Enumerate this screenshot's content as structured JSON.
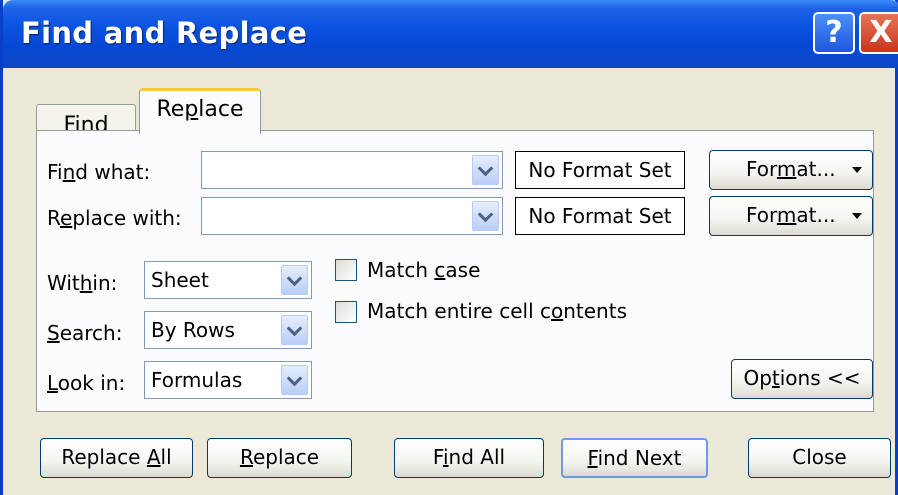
{
  "window": {
    "title": "Find and Replace",
    "help_glyph": "?",
    "close_glyph": "X"
  },
  "tabs": [
    {
      "label_pre": "Fin",
      "label_u": "d",
      "label_post": "",
      "active": false
    },
    {
      "label_pre": "Re",
      "label_u": "p",
      "label_post": "lace",
      "active": true
    }
  ],
  "find": {
    "label_pre": "Fi",
    "label_u": "n",
    "label_post": "d what:",
    "value": "",
    "format_status": "No Format Set",
    "format_btn": {
      "pre": "For",
      "u": "m",
      "post": "at..."
    }
  },
  "replace": {
    "label_pre": "R",
    "label_u": "e",
    "label_post": "place with:",
    "value": "",
    "format_status": "No Format Set",
    "format_btn": {
      "pre": "For",
      "u": "m",
      "post": "at..."
    }
  },
  "within": {
    "label_pre": "Wit",
    "label_u": "h",
    "label_post": "in:",
    "value": "Sheet"
  },
  "search": {
    "label_pre": "",
    "label_u": "S",
    "label_post": "earch:",
    "value": "By Rows"
  },
  "lookin": {
    "label_pre": "",
    "label_u": "L",
    "label_post": "ook in:",
    "value": "Formulas"
  },
  "match_case": {
    "pre": "Match ",
    "u": "c",
    "post": "ase",
    "checked": false
  },
  "match_entire": {
    "pre": "Match entire cell c",
    "u": "o",
    "post": "ntents",
    "checked": false
  },
  "options_btn": {
    "pre": "Op",
    "u": "t",
    "post": "ions <<"
  },
  "buttons": {
    "replace_all": {
      "pre": "Replace ",
      "u": "A",
      "post": "ll"
    },
    "replace": {
      "pre": "",
      "u": "R",
      "post": "eplace"
    },
    "find_all": {
      "pre": "F",
      "u": "i",
      "post": "nd All"
    },
    "find_next": {
      "pre": "",
      "u": "F",
      "post": "ind Next"
    },
    "close": {
      "pre": "Close",
      "u": "",
      "post": ""
    }
  },
  "colors": {
    "titlebar": "#0A52E0",
    "dialog_bg": "#ECE9D8",
    "active_tab_accent": "#FFC83C"
  }
}
